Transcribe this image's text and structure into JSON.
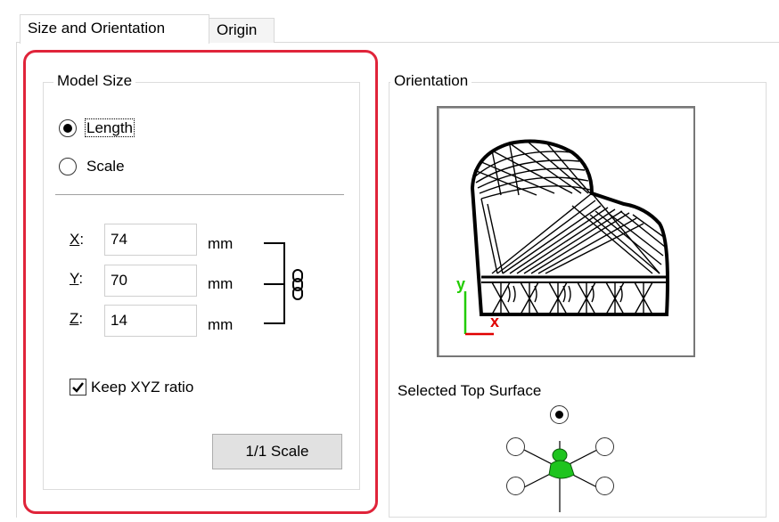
{
  "tabs": [
    {
      "label": "Size and Orientation",
      "active": true
    },
    {
      "label": "Origin",
      "active": false
    }
  ],
  "model_size": {
    "title": "Model Size",
    "radio_length": {
      "label": "Length",
      "selected": true
    },
    "radio_scale": {
      "label": "Scale",
      "selected": false
    },
    "x": {
      "label": "X:",
      "value": "74",
      "unit": "mm"
    },
    "y": {
      "label": "Y:",
      "value": "70",
      "unit": "mm"
    },
    "z": {
      "label": "Z:",
      "value": "14",
      "unit": "mm"
    },
    "link_icon": "chain-link-icon",
    "keep_ratio": {
      "label": "Keep XYZ ratio",
      "checked": true
    },
    "scale_button": "1/1 Scale"
  },
  "orientation": {
    "title": "Orientation",
    "axis_x": "x",
    "axis_y": "y",
    "selected_top_surface": "Selected Top Surface"
  },
  "colors": {
    "highlight": "#e0243a",
    "axis_x": "#e00000",
    "axis_y": "#22cc00",
    "model_green": "#1ec41e"
  }
}
